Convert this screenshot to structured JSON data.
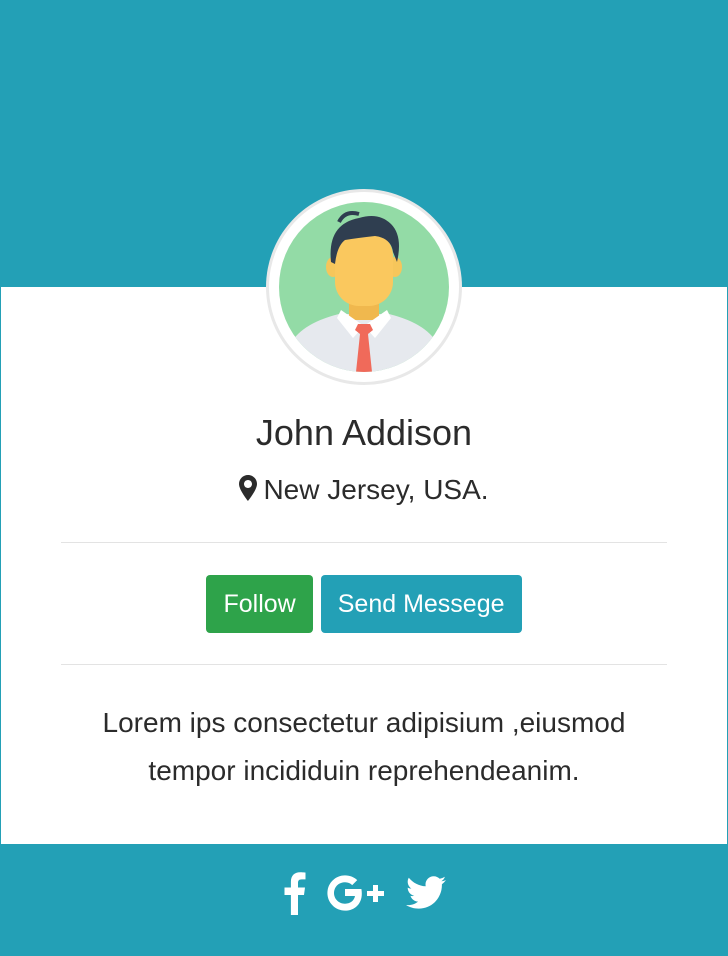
{
  "profile": {
    "name": "John Addison",
    "location": "New Jersey, USA.",
    "bio_line1": "Lorem ips consectetur adipisium ,eiusmod",
    "bio_line2": "tempor incididuin reprehendeanim."
  },
  "actions": {
    "follow_label": "Follow",
    "message_label": "Send Messege"
  },
  "icons": {
    "location": "map-marker-icon",
    "avatar": "user-avatar-icon",
    "social": [
      "facebook-icon",
      "google-plus-icon",
      "twitter-icon"
    ]
  },
  "colors": {
    "accent": "#23a0b6",
    "follow": "#2ea34a",
    "text": "#2b2b2b",
    "white": "#ffffff"
  }
}
